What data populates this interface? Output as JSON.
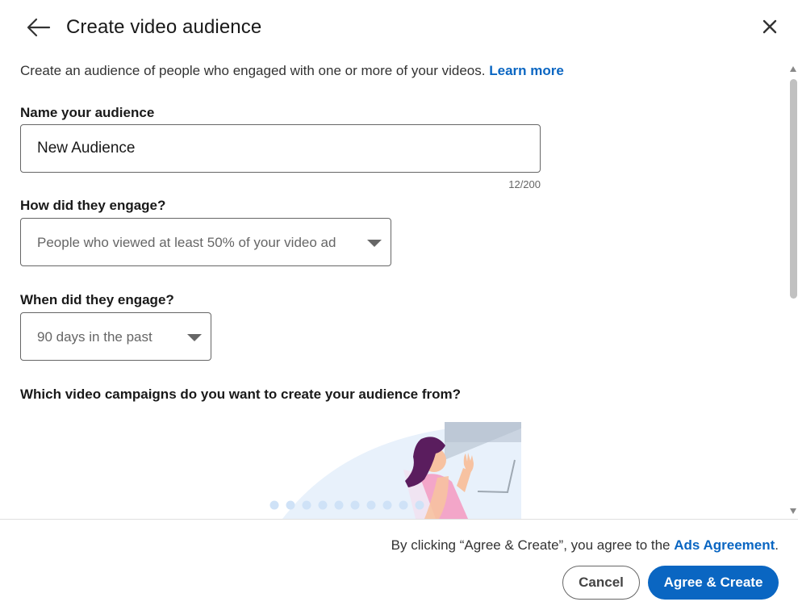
{
  "header": {
    "title": "Create video audience",
    "back_icon": "arrow-left-icon",
    "close_icon": "close-icon"
  },
  "intro": {
    "text": "Create an audience of people who engaged with one or more of your videos.",
    "learn_more": "Learn more"
  },
  "name_field": {
    "label": "Name your audience",
    "value": "New Audience",
    "counter": "12/200"
  },
  "engagement_type": {
    "label": "How did they engage?",
    "selected": "People who viewed at least 50% of your video ad"
  },
  "engagement_time": {
    "label": "When did they engage?",
    "selected": "90 days in the past"
  },
  "campaigns": {
    "label": "Which video campaigns do you want to create your audience from?"
  },
  "footer": {
    "agreement_prefix": "By clicking “Agree & Create”, you agree to the",
    "agreement_link": "Ads Agreement",
    "agreement_suffix": ".",
    "cancel_label": "Cancel",
    "submit_label": "Agree & Create"
  },
  "colors": {
    "accent": "#0a66c2",
    "text": "#191919",
    "border": "#666666"
  }
}
